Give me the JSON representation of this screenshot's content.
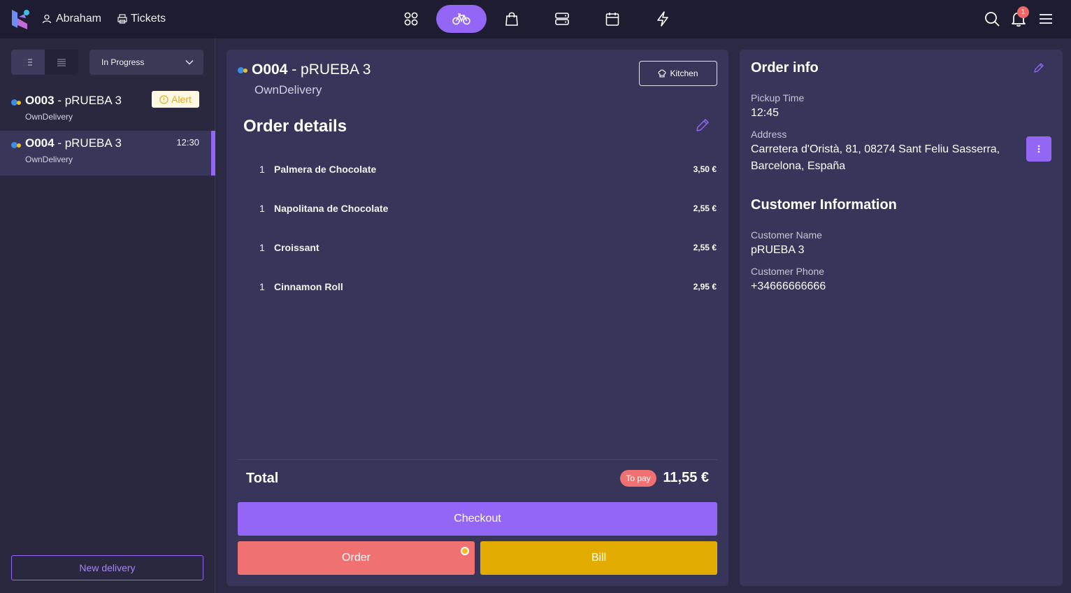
{
  "header": {
    "user_name": "Abraham",
    "tickets_label": "Tickets",
    "nav_icons": [
      "grid-icon",
      "bicycle-icon",
      "shopping-bag-icon",
      "server-icon",
      "calendar-icon",
      "lightning-icon"
    ],
    "active_nav": "bicycle-icon",
    "notification_count": "1"
  },
  "sidebar": {
    "status_filter": "In Progress",
    "orders": [
      {
        "code": "O003",
        "name": " - pRUEBA 3",
        "channel": "OwnDelivery",
        "badge": "Alert"
      },
      {
        "code": "O004",
        "name": " - pRUEBA 3",
        "channel": "OwnDelivery",
        "time": "12:30"
      }
    ],
    "new_delivery_label": "New delivery"
  },
  "order": {
    "code": "O004",
    "name": " - pRUEBA 3",
    "channel": "OwnDelivery",
    "kitchen_label": "Kitchen",
    "details_title": "Order details",
    "lines": [
      {
        "qty": "1",
        "name": "Palmera de Chocolate",
        "price": "3,50 €"
      },
      {
        "qty": "1",
        "name": "Napolitana de Chocolate",
        "price": "2,55 €"
      },
      {
        "qty": "1",
        "name": "Croissant",
        "price": "2,55 €"
      },
      {
        "qty": "1",
        "name": "Cinnamon Roll",
        "price": "2,95 €"
      }
    ],
    "total_label": "Total",
    "to_pay_label": "To pay",
    "total_value": "11,55 €",
    "checkout_label": "Checkout",
    "order_label": "Order",
    "bill_label": "Bill"
  },
  "info": {
    "title": "Order info",
    "pickup_label": "Pickup Time",
    "pickup_value": "12:45",
    "address_label": "Address",
    "address_line1": "Carretera d'Oristà, 81, 08274 Sant Feliu Sasserra,",
    "address_line2": "Barcelona, España",
    "customer_title": "Customer Information",
    "customer_name_label": "Customer Name",
    "customer_name": "pRUEBA 3",
    "customer_phone_label": "Customer Phone",
    "customer_phone": "+34666666666"
  },
  "colors": {
    "accent": "#9466f6",
    "danger": "#f07172",
    "warning": "#e3ac02",
    "background": "#2b2a45",
    "panel": "#37365a"
  }
}
